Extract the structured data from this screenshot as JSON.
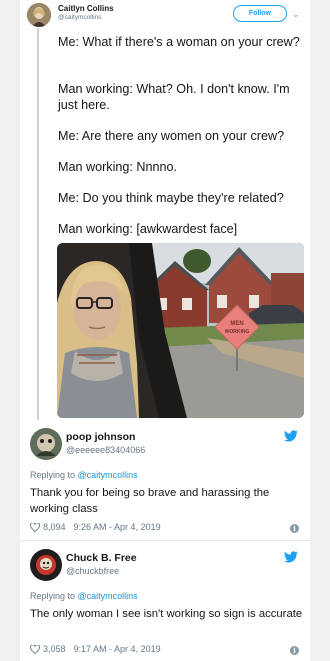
{
  "tweet": {
    "author": "Caitlyn Collins",
    "handle": "@caitymcollins",
    "follow_label": "Follow",
    "lines": [
      "Me: What if there's a woman on your crew?",
      "Man working: What? Oh. I don't know. I'm just here.",
      "Me: Are there any women on your crew?",
      "Man working: Nnnno.",
      "Me: Do you think maybe they're related?",
      "Man working: [awkwardest face]"
    ],
    "sign_text": [
      "MEN",
      "WORKING"
    ]
  },
  "replies": [
    {
      "name": "poop johnson",
      "handle": "@eeeeee83404066",
      "replying_prefix": "Replying to ",
      "replying_to": "@caitymcollins",
      "text": "Thank you for being so brave and harassing the working class",
      "likes": "8,094",
      "time": "9:26 AM - Apr 4, 2019"
    },
    {
      "name": "Chuck B. Free",
      "handle": "@chuckbfree",
      "replying_prefix": "Replying to ",
      "replying_to": "@caitymcollins",
      "text": "The only woman I see isn't working so sign is accurate",
      "likes": "3,058",
      "time": "9:17 AM - Apr 4, 2019"
    }
  ],
  "colors": {
    "twitter_blue": "#1da1f2",
    "link_blue": "#1b95e0",
    "muted": "#657786",
    "sign_pink": "#e8807e"
  },
  "icons": [
    "twitter-bird-icon",
    "heart-icon",
    "info-icon",
    "chevron-down-icon"
  ]
}
